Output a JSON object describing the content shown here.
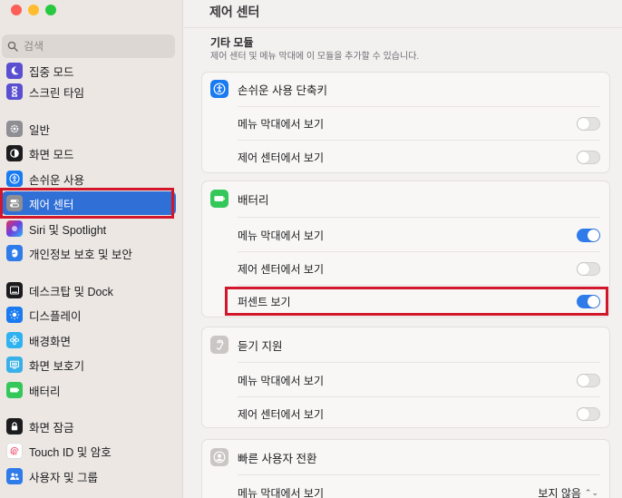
{
  "window": {
    "title": "제어 센터"
  },
  "colors": {
    "accent": "#2f6fd6",
    "toggle_on": "#2f7bea",
    "highlight": "#d3172a"
  },
  "search": {
    "placeholder": "검색"
  },
  "sidebar": {
    "items": [
      {
        "label": "집중 모드",
        "icon": "moon-icon"
      },
      {
        "label": "스크린 타임",
        "icon": "hourglass-icon"
      },
      {
        "label": "일반",
        "icon": "gear-icon"
      },
      {
        "label": "화면 모드",
        "icon": "appearance-icon"
      },
      {
        "label": "손쉬운 사용",
        "icon": "accessibility-icon"
      },
      {
        "label": "제어 센터",
        "icon": "control-center-icon",
        "selected": true
      },
      {
        "label": "Siri 및 Spotlight",
        "icon": "siri-icon"
      },
      {
        "label": "개인정보 보호 및 보안",
        "icon": "hand-icon"
      },
      {
        "label": "데스크탑 및 Dock",
        "icon": "dock-icon"
      },
      {
        "label": "디스플레이",
        "icon": "display-icon"
      },
      {
        "label": "배경화면",
        "icon": "wallpaper-icon"
      },
      {
        "label": "화면 보호기",
        "icon": "screensaver-icon"
      },
      {
        "label": "배터리",
        "icon": "battery-icon"
      },
      {
        "label": "화면 잠금",
        "icon": "lock-icon"
      },
      {
        "label": "Touch ID 및 암호",
        "icon": "fingerprint-icon"
      },
      {
        "label": "사용자 및 그룹",
        "icon": "users-icon"
      }
    ]
  },
  "main": {
    "section_title": "기타 모듈",
    "section_subtitle": "제어 센터 및 메뉴 막대에 이 모듈을 추가할 수 있습니다.",
    "modules": [
      {
        "name": "손쉬운 사용 단축키",
        "icon": "accessibility-shortcut-icon",
        "rows": [
          {
            "label": "메뉴 막대에서 보기",
            "on": false
          },
          {
            "label": "제어 센터에서 보기",
            "on": false
          }
        ]
      },
      {
        "name": "배터리",
        "icon": "battery-icon",
        "rows": [
          {
            "label": "메뉴 막대에서 보기",
            "on": true
          },
          {
            "label": "제어 센터에서 보기",
            "on": false
          },
          {
            "label": "퍼센트 보기",
            "on": true
          }
        ]
      },
      {
        "name": "듣기 지원",
        "icon": "ear-icon",
        "rows": [
          {
            "label": "메뉴 막대에서 보기",
            "on": false
          },
          {
            "label": "제어 센터에서 보기",
            "on": false
          }
        ]
      },
      {
        "name": "빠른 사용자 전환",
        "icon": "user-switch-icon",
        "rows": [
          {
            "label": "메뉴 막대에서 보기",
            "popup_value": "보지 않음"
          }
        ]
      }
    ]
  }
}
